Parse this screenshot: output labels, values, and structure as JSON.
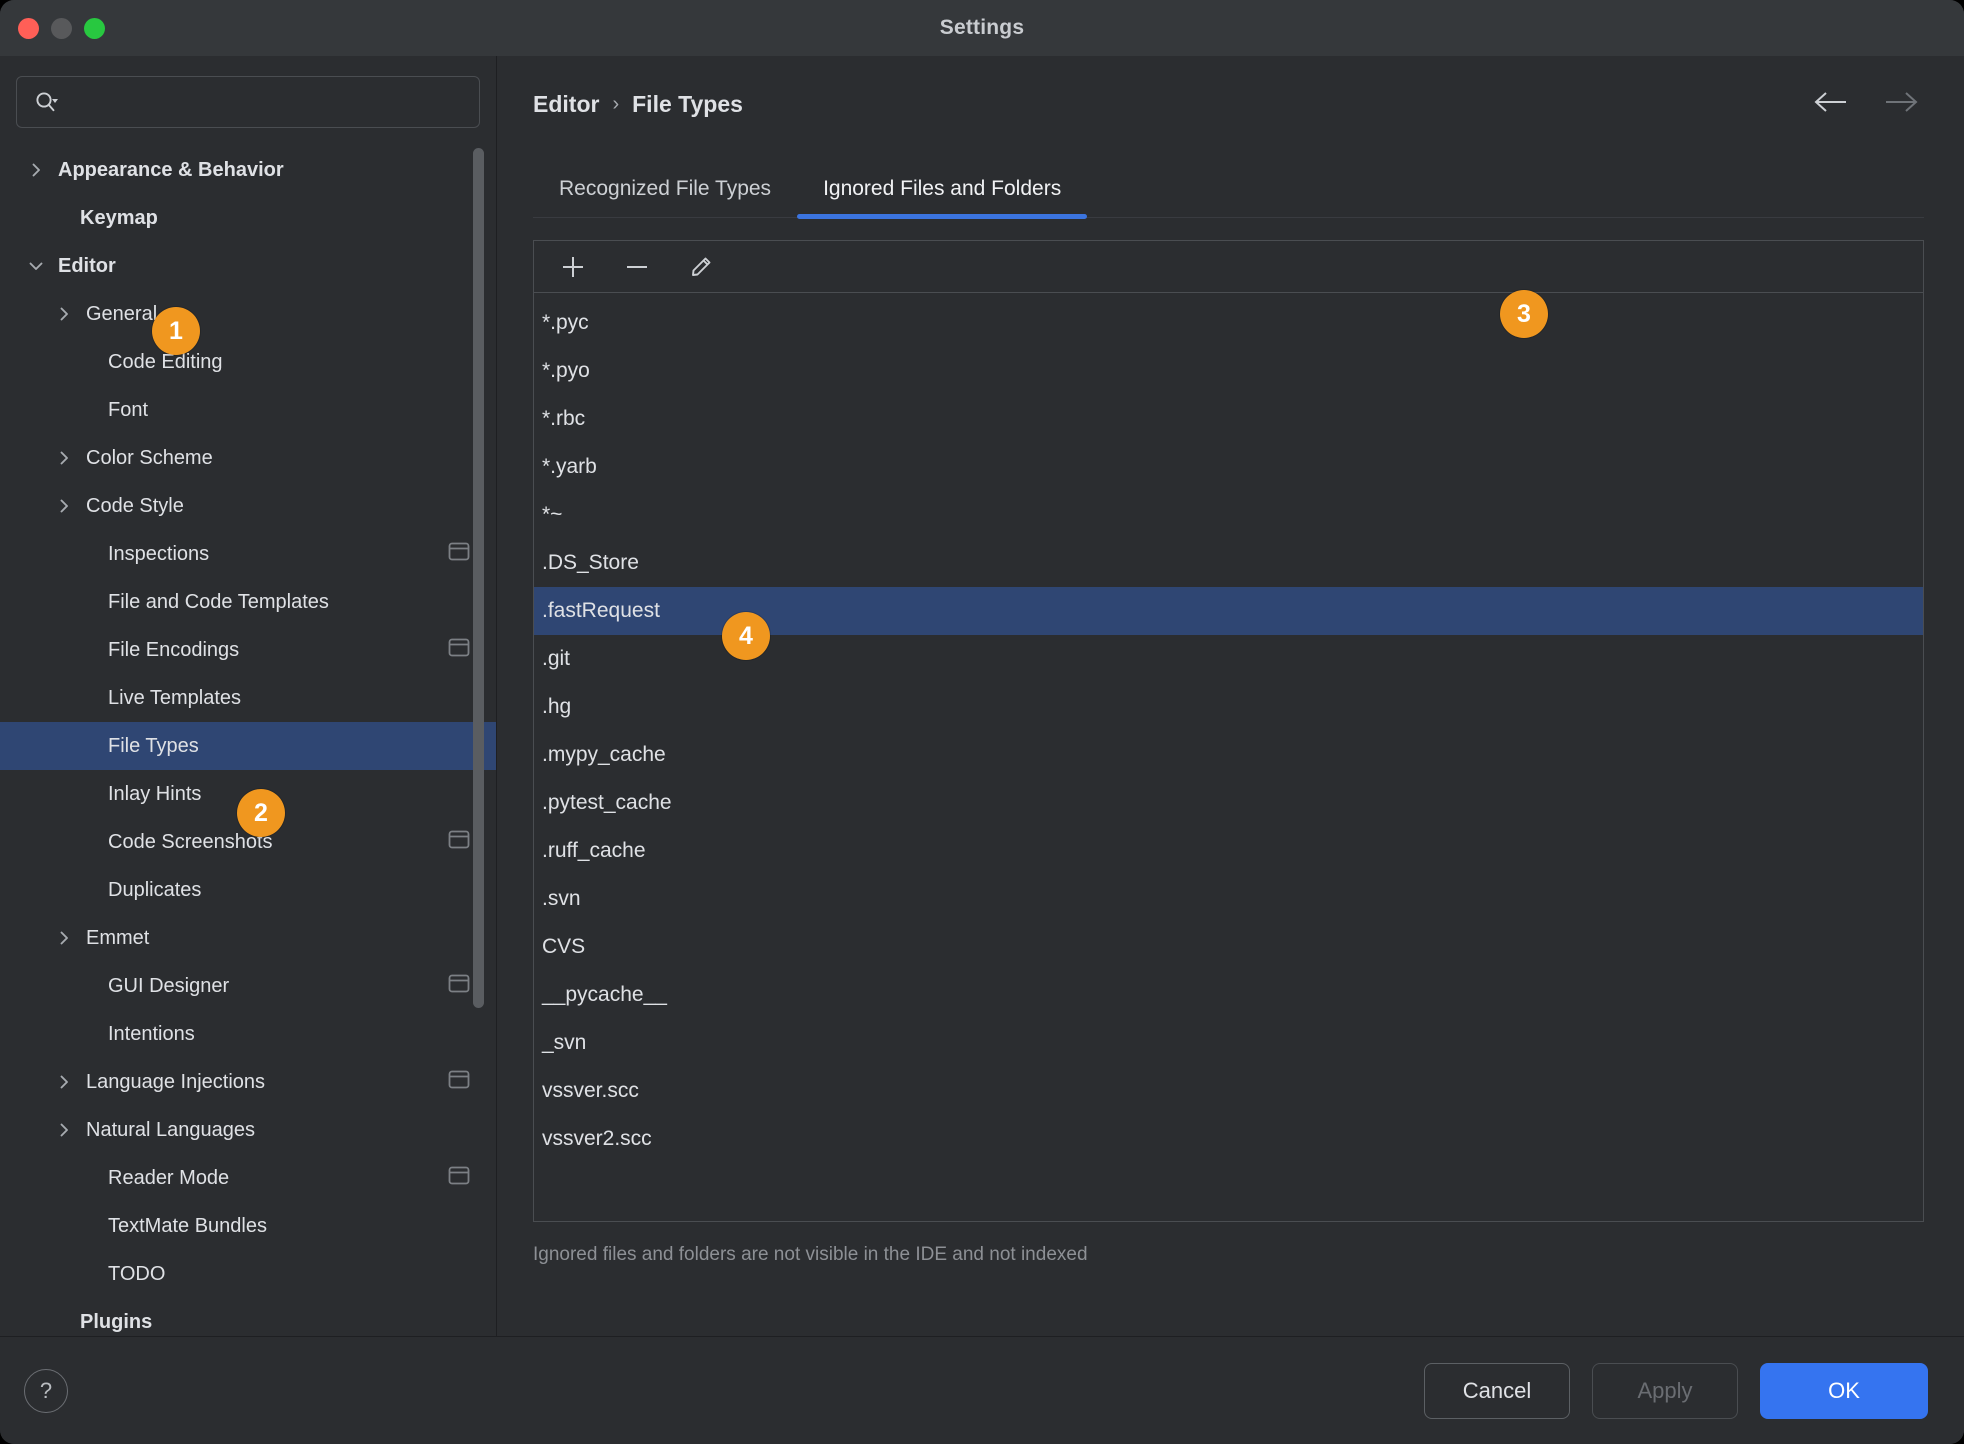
{
  "window": {
    "title": "Settings",
    "traffic_lights": [
      "close",
      "minimize",
      "zoom"
    ]
  },
  "sidebar": {
    "search": {
      "value": "",
      "placeholder": ""
    },
    "items": [
      {
        "label": "Appearance & Behavior",
        "level": 0,
        "expandable": true,
        "expanded": false,
        "selected": false,
        "badge": false
      },
      {
        "label": "Keymap",
        "level": 0,
        "expandable": false,
        "expanded": false,
        "selected": false,
        "badge": false
      },
      {
        "label": "Editor",
        "level": 0,
        "expandable": true,
        "expanded": true,
        "selected": false,
        "badge": false
      },
      {
        "label": "General",
        "level": 1,
        "expandable": true,
        "expanded": false,
        "selected": false,
        "badge": false
      },
      {
        "label": "Code Editing",
        "level": 1,
        "expandable": false,
        "expanded": false,
        "selected": false,
        "badge": false
      },
      {
        "label": "Font",
        "level": 1,
        "expandable": false,
        "expanded": false,
        "selected": false,
        "badge": false
      },
      {
        "label": "Color Scheme",
        "level": 1,
        "expandable": true,
        "expanded": false,
        "selected": false,
        "badge": false
      },
      {
        "label": "Code Style",
        "level": 1,
        "expandable": true,
        "expanded": false,
        "selected": false,
        "badge": false
      },
      {
        "label": "Inspections",
        "level": 1,
        "expandable": false,
        "expanded": false,
        "selected": false,
        "badge": true
      },
      {
        "label": "File and Code Templates",
        "level": 1,
        "expandable": false,
        "expanded": false,
        "selected": false,
        "badge": false
      },
      {
        "label": "File Encodings",
        "level": 1,
        "expandable": false,
        "expanded": false,
        "selected": false,
        "badge": true
      },
      {
        "label": "Live Templates",
        "level": 1,
        "expandable": false,
        "expanded": false,
        "selected": false,
        "badge": false
      },
      {
        "label": "File Types",
        "level": 1,
        "expandable": false,
        "expanded": false,
        "selected": true,
        "badge": false
      },
      {
        "label": "Inlay Hints",
        "level": 1,
        "expandable": false,
        "expanded": false,
        "selected": false,
        "badge": false
      },
      {
        "label": "Code Screenshots",
        "level": 1,
        "expandable": false,
        "expanded": false,
        "selected": false,
        "badge": true
      },
      {
        "label": "Duplicates",
        "level": 1,
        "expandable": false,
        "expanded": false,
        "selected": false,
        "badge": false
      },
      {
        "label": "Emmet",
        "level": 1,
        "expandable": true,
        "expanded": false,
        "selected": false,
        "badge": false
      },
      {
        "label": "GUI Designer",
        "level": 1,
        "expandable": false,
        "expanded": false,
        "selected": false,
        "badge": true
      },
      {
        "label": "Intentions",
        "level": 1,
        "expandable": false,
        "expanded": false,
        "selected": false,
        "badge": false
      },
      {
        "label": "Language Injections",
        "level": 1,
        "expandable": true,
        "expanded": false,
        "selected": false,
        "badge": true
      },
      {
        "label": "Natural Languages",
        "level": 1,
        "expandable": true,
        "expanded": false,
        "selected": false,
        "badge": false
      },
      {
        "label": "Reader Mode",
        "level": 1,
        "expandable": false,
        "expanded": false,
        "selected": false,
        "badge": true
      },
      {
        "label": "TextMate Bundles",
        "level": 1,
        "expandable": false,
        "expanded": false,
        "selected": false,
        "badge": false
      },
      {
        "label": "TODO",
        "level": 1,
        "expandable": false,
        "expanded": false,
        "selected": false,
        "badge": false
      },
      {
        "label": "Plugins",
        "level": 0,
        "expandable": false,
        "expanded": false,
        "selected": false,
        "badge": false
      }
    ]
  },
  "main": {
    "breadcrumb": {
      "parent": "Editor",
      "separator": "›",
      "current": "File Types"
    },
    "nav": {
      "back_icon": "arrow-left-icon",
      "forward_icon": "arrow-right-icon"
    },
    "tabs": [
      {
        "label": "Recognized File Types",
        "active": false
      },
      {
        "label": "Ignored Files and Folders",
        "active": true
      }
    ],
    "toolbar": [
      {
        "icon": "plus-icon",
        "name": "add-button"
      },
      {
        "icon": "minus-icon",
        "name": "remove-button"
      },
      {
        "icon": "pencil-icon",
        "name": "edit-button"
      }
    ],
    "list": {
      "items": [
        {
          "value": "*.pyc",
          "selected": false
        },
        {
          "value": "*.pyo",
          "selected": false
        },
        {
          "value": "*.rbc",
          "selected": false
        },
        {
          "value": "*.yarb",
          "selected": false
        },
        {
          "value": "*~",
          "selected": false
        },
        {
          "value": ".DS_Store",
          "selected": false
        },
        {
          "value": ".fastRequest",
          "selected": true
        },
        {
          "value": ".git",
          "selected": false
        },
        {
          "value": ".hg",
          "selected": false
        },
        {
          "value": ".mypy_cache",
          "selected": false
        },
        {
          "value": ".pytest_cache",
          "selected": false
        },
        {
          "value": ".ruff_cache",
          "selected": false
        },
        {
          "value": ".svn",
          "selected": false
        },
        {
          "value": "CVS",
          "selected": false
        },
        {
          "value": "__pycache__",
          "selected": false
        },
        {
          "value": "_svn",
          "selected": false
        },
        {
          "value": "vssver.scc",
          "selected": false
        },
        {
          "value": "vssver2.scc",
          "selected": false
        }
      ]
    },
    "hint": "Ignored files and folders are not visible in the IDE and not indexed"
  },
  "footer": {
    "help_label": "?",
    "cancel_label": "Cancel",
    "apply_label": "Apply",
    "ok_label": "OK",
    "apply_enabled": false
  },
  "annotations": [
    {
      "number": "1",
      "target": "sidebar-item-editor"
    },
    {
      "number": "2",
      "target": "sidebar-item-file-types"
    },
    {
      "number": "3",
      "target": "tab-ignored-files-and-folders"
    },
    {
      "number": "4",
      "target": "list-item-fastrequest"
    }
  ],
  "colors": {
    "window_bg": "#2b2d30",
    "titlebar_bg": "#35383b",
    "selection_blue": "#2f4673",
    "accent_blue": "#3574f0",
    "tab_underline": "#3b74df",
    "annotation_orange": "#f0971f",
    "text_primary": "#dfe1e5",
    "text_muted": "#8d9095"
  }
}
